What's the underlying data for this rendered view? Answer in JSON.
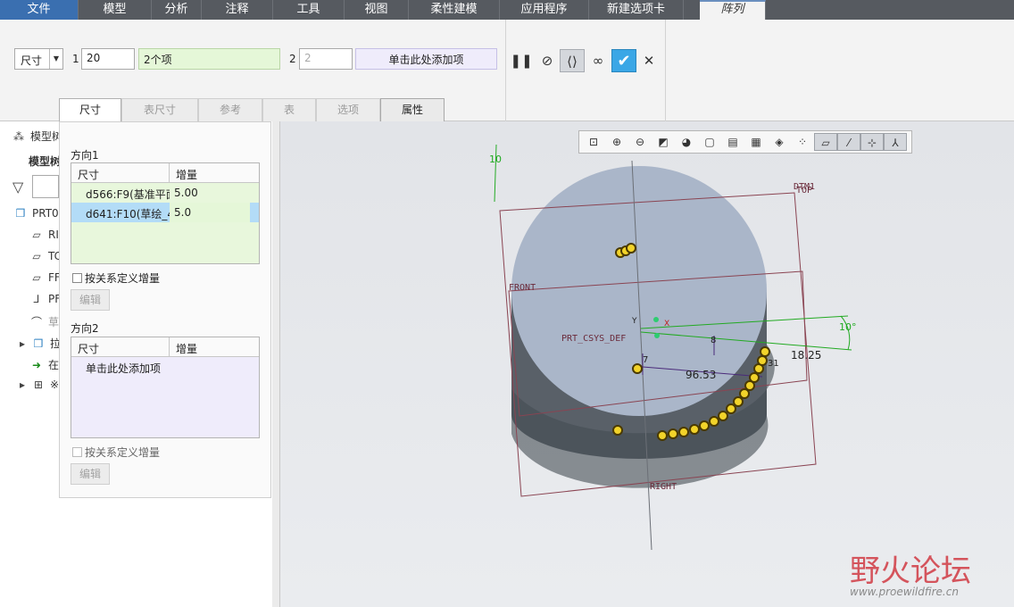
{
  "ribbon": {
    "tabs": [
      "文件",
      "模型",
      "分析",
      "注释",
      "工具",
      "视图",
      "柔性建模",
      "应用程序",
      "新建选项卡",
      "阵列"
    ]
  },
  "dashboard": {
    "type_select": "尺寸",
    "dir1_index": "1",
    "dir1_count": "20",
    "dir1_items": "2个项",
    "dir2_index": "2",
    "dir2_count": "2",
    "dir2_add": "单击此处添加项",
    "subtabs": [
      "尺寸",
      "表尺寸",
      "参考",
      "表",
      "选项",
      "属性"
    ],
    "pause_icon": "pause-icon",
    "stop_icon": "no-entry-icon",
    "preview_icon": "preview-icon",
    "glasses_icon": "glasses-icon",
    "ok_icon": "checkmark-icon",
    "cancel_icon": "close-icon"
  },
  "tree": {
    "header": "模型树",
    "sub_header": "模型树",
    "items": [
      "PRT0",
      "RI",
      "TC",
      "FF",
      "PF",
      "草",
      "拉",
      "在",
      "※"
    ]
  },
  "panel": {
    "dir1_title": "方向1",
    "dir2_title": "方向2",
    "col_dim": "尺寸",
    "col_inc": "增量",
    "rows": [
      {
        "dim": "d566:F9(基准平面",
        "inc": "5.00"
      },
      {
        "dim": "d641:F10(草绘_4",
        "inc": "5.0"
      }
    ],
    "dir2_add": "单击此处添加项",
    "relation_label": "按关系定义增量",
    "edit_label": "编辑"
  },
  "graphics": {
    "labels": {
      "top": "TOP",
      "dtm": "DTM1",
      "front": "FRONT",
      "right": "RIGHT",
      "csys": "PRT_CSYS_DEF",
      "dim_10a": "10",
      "dim_10b": "10°",
      "dim_9653": "96.53",
      "dim_1825": "18.25",
      "dim_7": "7",
      "dim_31": "31",
      "dim_8": "8",
      "axis_y": "Y",
      "axis_x": "X"
    }
  },
  "watermark": {
    "title": "野火论坛",
    "url": "www.proewildfire.cn"
  }
}
